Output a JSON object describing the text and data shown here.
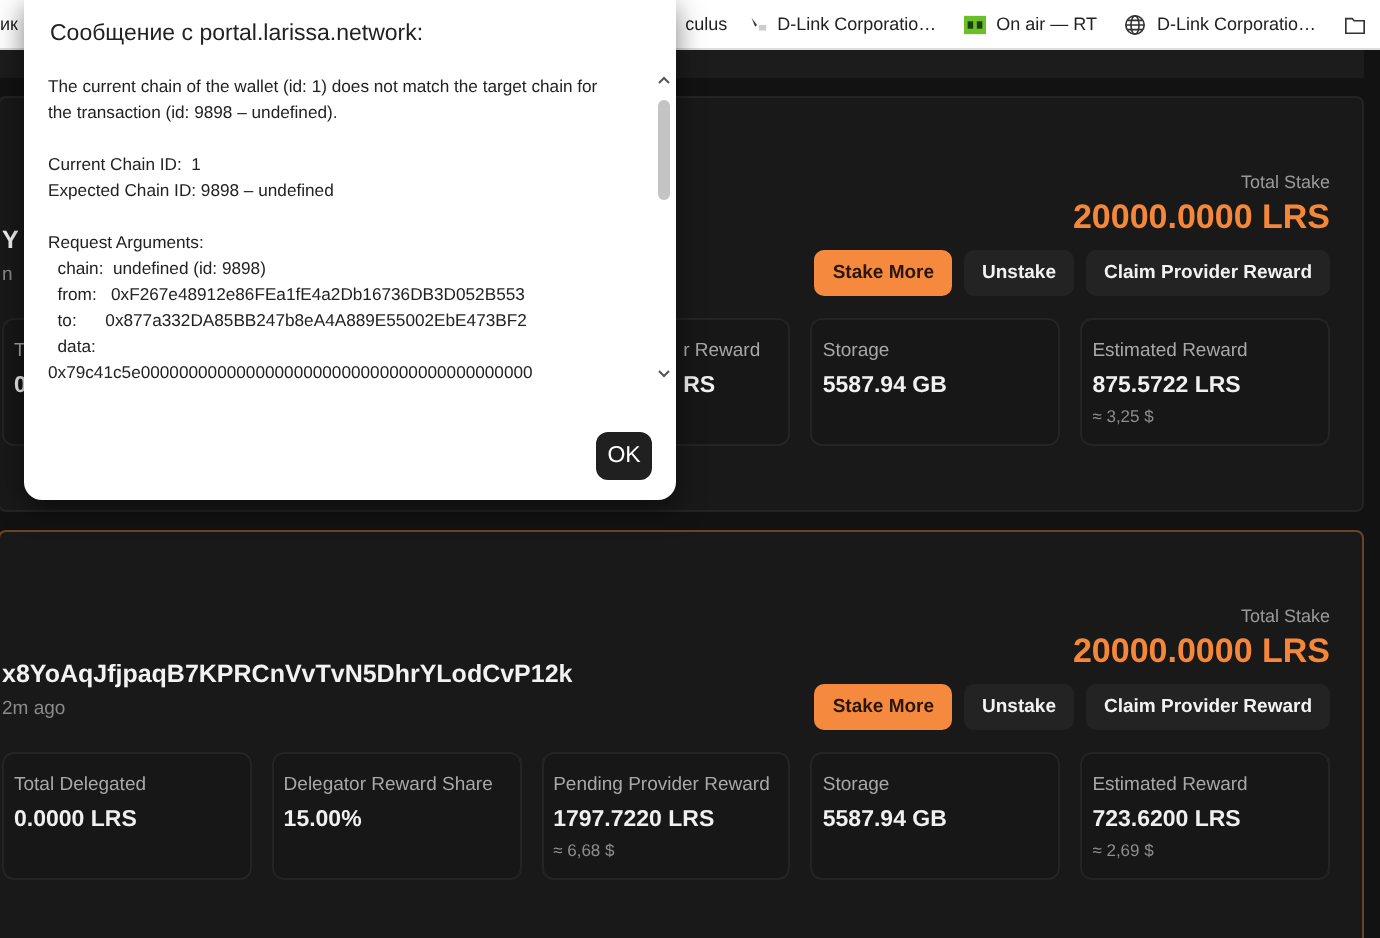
{
  "bookmarks_bar": {
    "items": [
      {
        "kind": "text",
        "label": "ик"
      },
      {
        "kind": "text",
        "label": "culus"
      },
      {
        "kind": "favicon",
        "label": "D-Link Corporatio…"
      },
      {
        "kind": "rt",
        "label": "On air — RT"
      },
      {
        "kind": "globe",
        "label": "D-Link Corporatio…"
      },
      {
        "kind": "folder"
      }
    ]
  },
  "providers": [
    {
      "highlighted": false,
      "title": "Y",
      "subtitle": "n",
      "total_stake_label": "Total Stake",
      "total_stake": "20000.0000 LRS",
      "buttons": [
        {
          "kind": "primary",
          "label": "Stake More"
        },
        {
          "kind": "secondary",
          "label": "Unstake"
        },
        {
          "kind": "secondary",
          "label": "Claim Provider Reward"
        }
      ],
      "stats": [
        {
          "label": "T",
          "value": "0"
        },
        {
          "label": "r Reward",
          "value": "RS"
        },
        {
          "label": "Storage",
          "value": "5587.94 GB"
        },
        {
          "label": "Estimated Reward",
          "value": "875.5722 LRS",
          "usd": "≈ 3,25 $"
        }
      ]
    },
    {
      "highlighted": true,
      "title": "x8YoAqJfjpaqB7KPRCnVvTvN5DhrYLodCvP12k",
      "subtitle": "2m ago",
      "total_stake_label": "Total Stake",
      "total_stake": "20000.0000 LRS",
      "buttons": [
        {
          "kind": "primary",
          "label": "Stake More"
        },
        {
          "kind": "secondary",
          "label": "Unstake"
        },
        {
          "kind": "secondary",
          "label": "Claim Provider Reward"
        }
      ],
      "stats": [
        {
          "label": "Total Delegated",
          "value": "0.0000 LRS"
        },
        {
          "label": "Delegator Reward Share",
          "value": "15.00%"
        },
        {
          "label": "Pending Provider Reward",
          "value": "1797.7220 LRS",
          "usd": "≈ 6,68 $"
        },
        {
          "label": "Storage",
          "value": "5587.94 GB"
        },
        {
          "label": "Estimated Reward",
          "value": "723.6200 LRS",
          "usd": "≈ 2,69 $"
        }
      ]
    }
  ],
  "dialog": {
    "title": "Сообщение с portal.larissa.network:",
    "paragraphs": [
      "The current chain of the wallet (id: 1) does not match the target chain for the transaction (id: 9898 – undefined).",
      "Current Chain ID:  1\nExpected Chain ID: 9898 – undefined",
      "Request Arguments:\n  chain:  undefined (id: 9898)\n  from:   0xF267e48912e86FEa1fE4a2Db16736DB3D052B553\n  to:      0x877a332DA85BB247b8eA4A889E55002EbE473BF2\n  data:\n0x79c41c5e00000000000000000000000000000000000000000"
    ],
    "ok_button": "OK"
  }
}
